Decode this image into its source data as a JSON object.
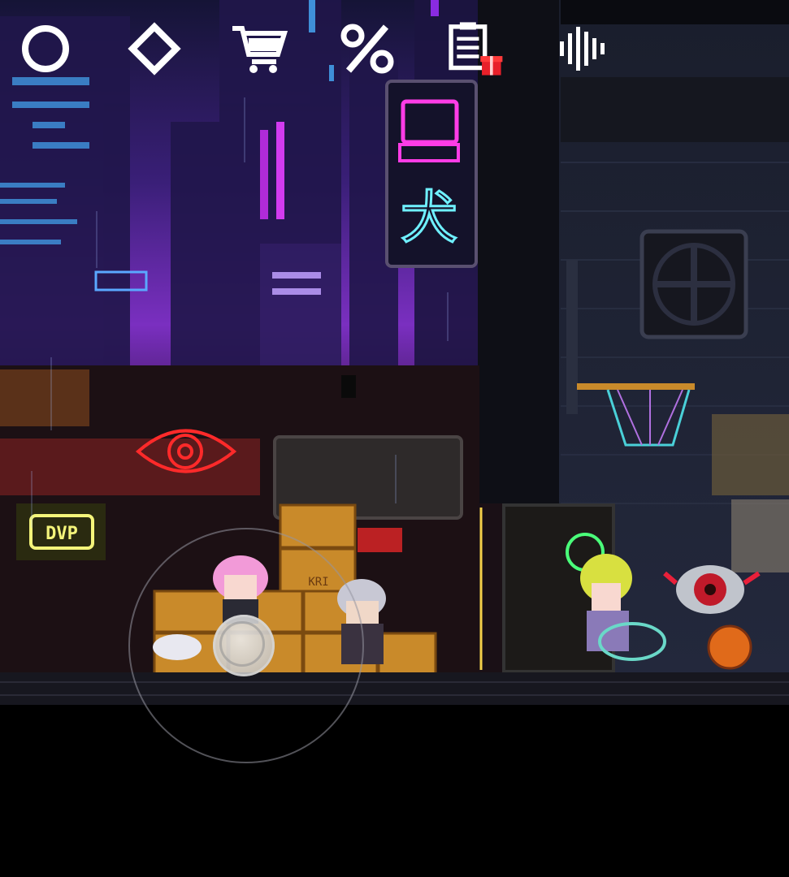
{
  "hud": {
    "buttons": [
      {
        "icon": "circle-icon"
      },
      {
        "icon": "diamond-icon"
      },
      {
        "icon": "shopping-cart-icon"
      },
      {
        "icon": "percent-icon"
      },
      {
        "icon": "clipboard-gift-icon"
      },
      {
        "icon": "sound-wave-icon"
      }
    ]
  },
  "signs": {
    "neon_kanji": "犬",
    "crate_label": "KRI",
    "small_sign": "DVP"
  },
  "colors": {
    "sky_top": "#1a1440",
    "sky_purple": "#6a2fb0",
    "neon_pink": "#ff3ce6",
    "neon_cyan": "#6ff0ff",
    "neon_red": "#ff2a2a",
    "neon_yellow": "#f4f47a",
    "ground": "#121218"
  }
}
